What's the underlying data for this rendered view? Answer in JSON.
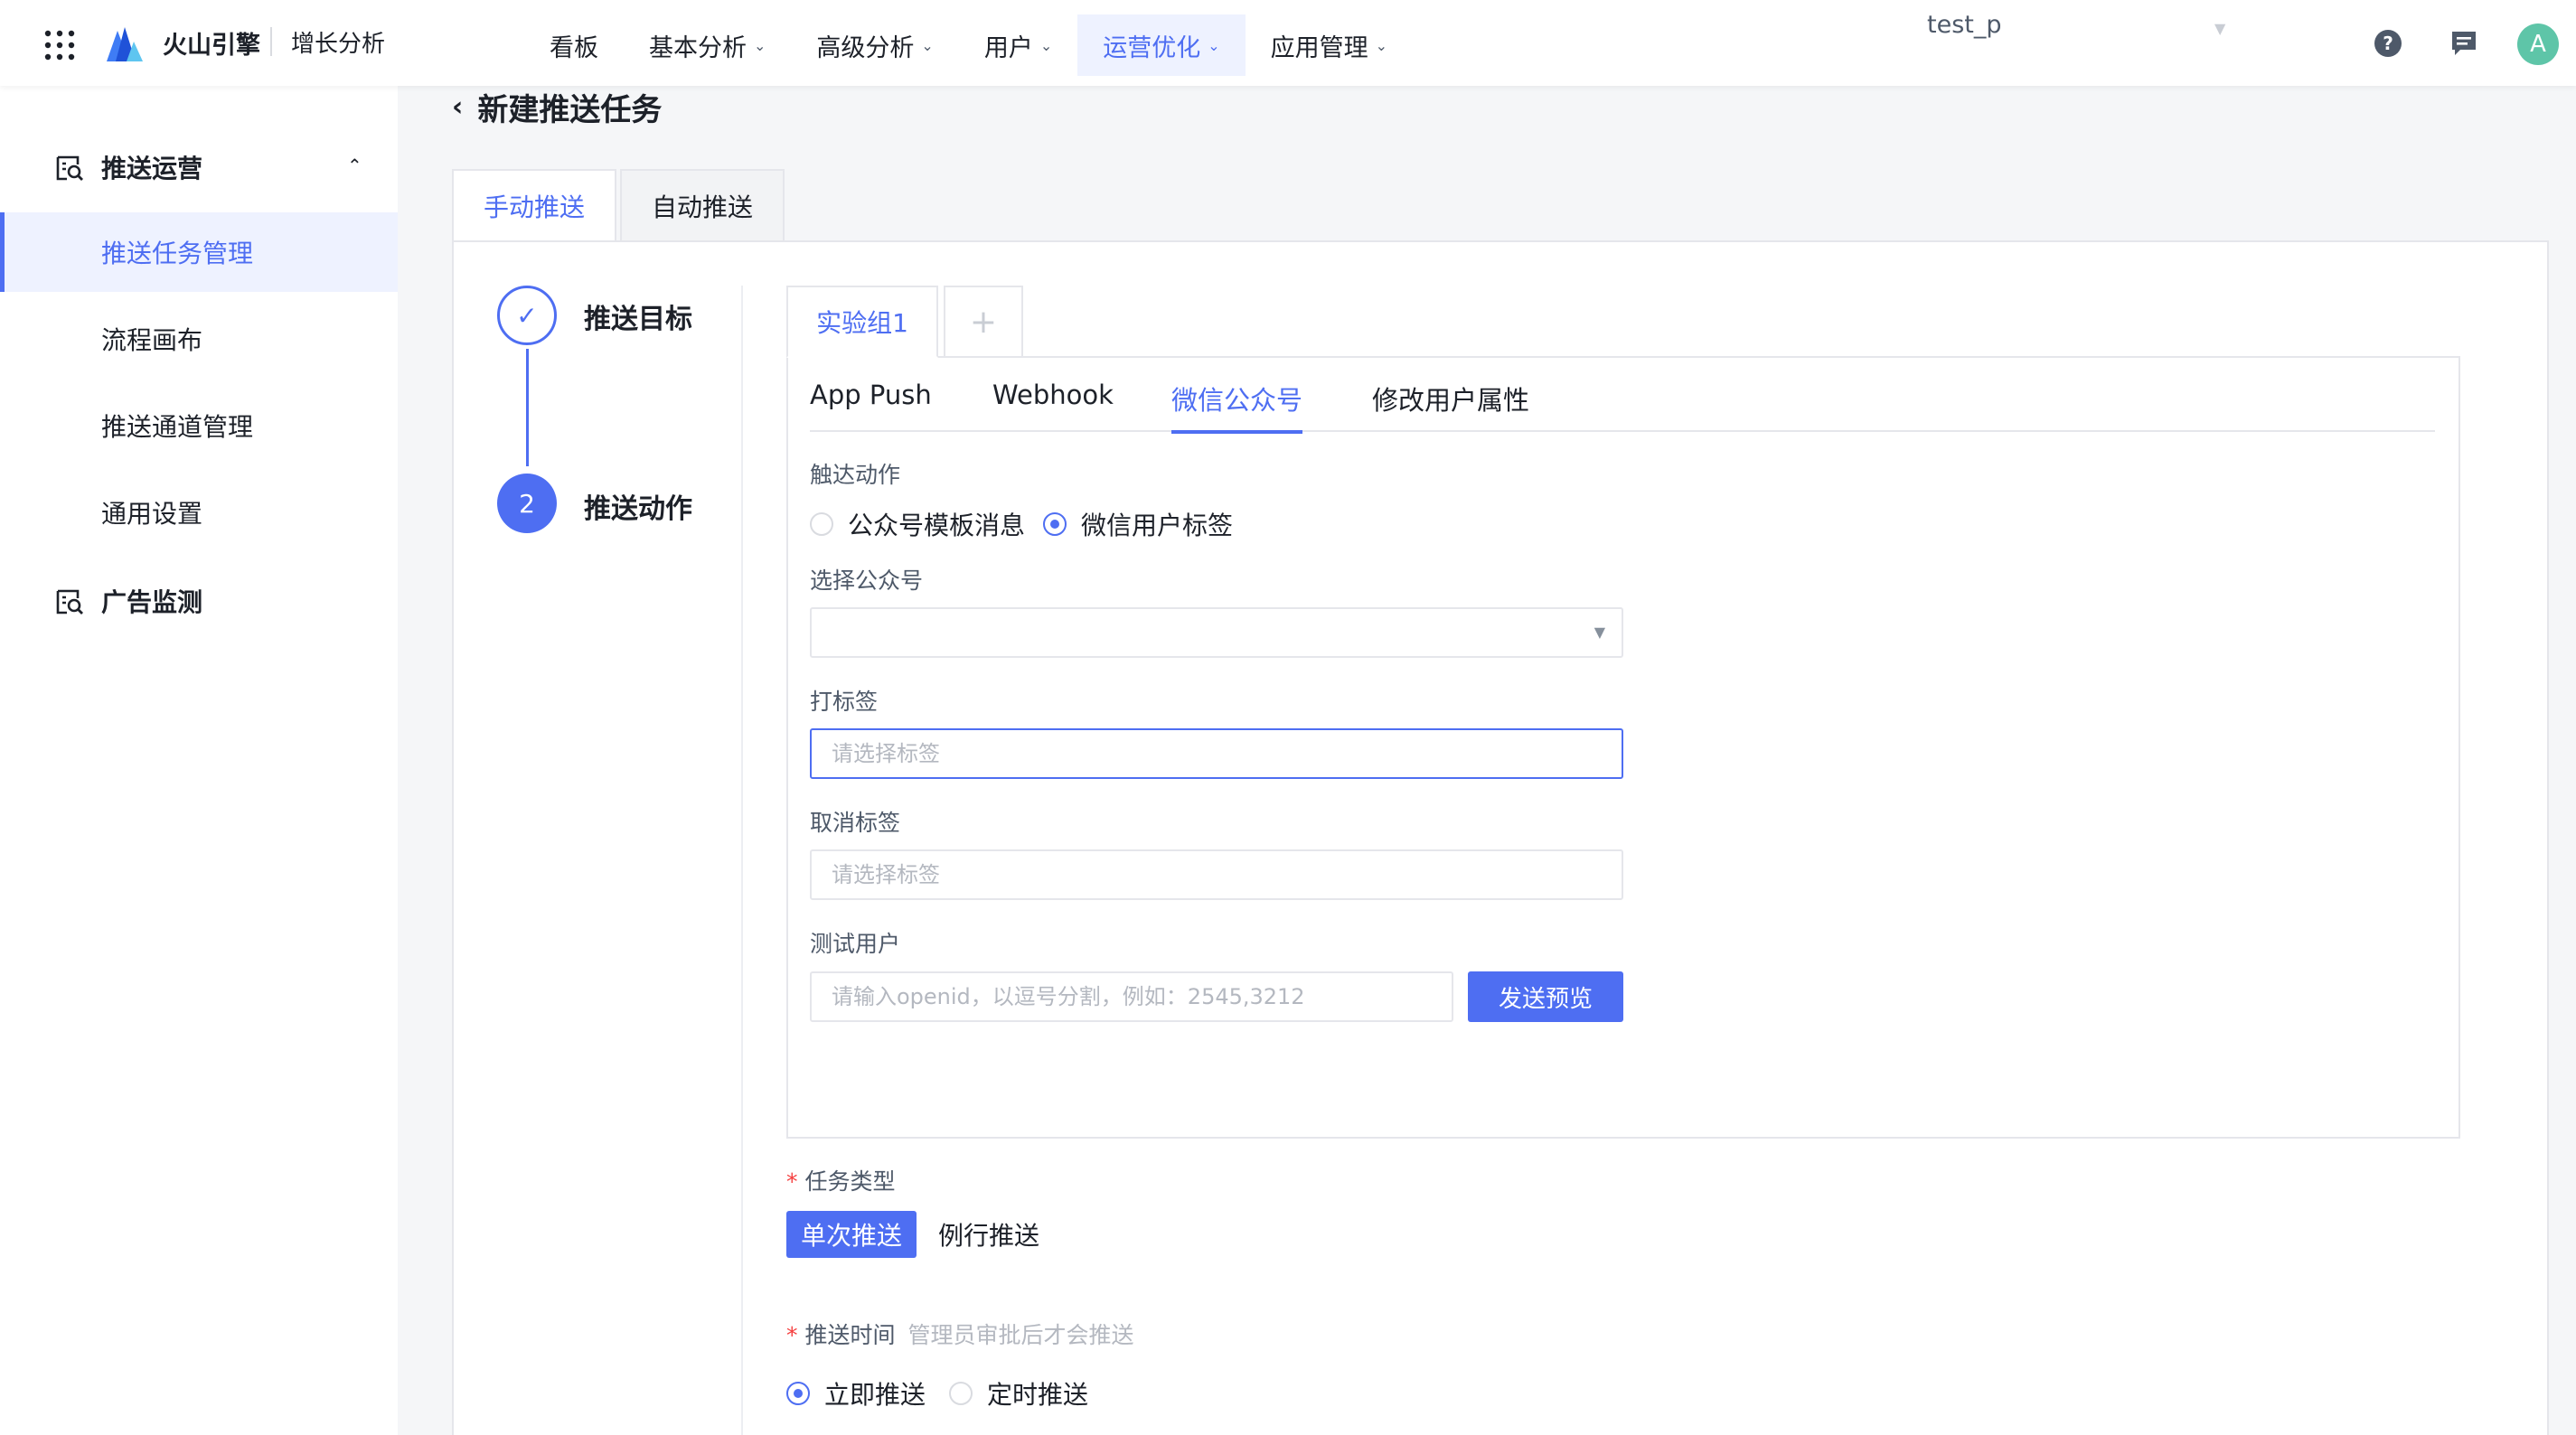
{
  "topbar": {
    "brand": "火山引擎",
    "product": "增长分析",
    "nav": [
      {
        "label": "看板",
        "has_dropdown": false,
        "active": false
      },
      {
        "label": "基本分析",
        "has_dropdown": true,
        "active": false
      },
      {
        "label": "高级分析",
        "has_dropdown": true,
        "active": false
      },
      {
        "label": "用户",
        "has_dropdown": true,
        "active": false
      },
      {
        "label": "运营优化",
        "has_dropdown": true,
        "active": true
      },
      {
        "label": "应用管理",
        "has_dropdown": true,
        "active": false
      }
    ],
    "chevron": "⌄",
    "project": "test_p",
    "project_caret": "▼",
    "avatar_letter": "A",
    "icons": [
      "apps-grid-icon",
      "volcano-logo-icon",
      "help-icon",
      "message-icon"
    ]
  },
  "sidebar": {
    "groups": [
      {
        "label": "推送运营",
        "expanded": true,
        "chevron": "⌃"
      },
      {
        "label": "广告监测",
        "expanded": false
      }
    ],
    "items": [
      {
        "label": "推送任务管理",
        "active": true
      },
      {
        "label": "流程画布",
        "active": false
      },
      {
        "label": "推送通道管理",
        "active": false
      },
      {
        "label": "通用设置",
        "active": false
      }
    ]
  },
  "page": {
    "back_arrow": "‹",
    "title": "新建推送任务",
    "tabs": [
      {
        "label": "手动推送",
        "active": true
      },
      {
        "label": "自动推送",
        "active": false
      }
    ]
  },
  "steps": [
    {
      "label": "推送目标",
      "status": "done",
      "mark": "✓"
    },
    {
      "label": "推送动作",
      "status": "current",
      "mark": "2"
    }
  ],
  "groups": {
    "tabs": [
      {
        "label": "实验组1",
        "active": true
      }
    ],
    "add_label": "+"
  },
  "channels": {
    "tabs": [
      {
        "label": "App Push",
        "active": false
      },
      {
        "label": "Webhook",
        "active": false
      },
      {
        "label": "微信公众号",
        "active": true
      },
      {
        "label": "修改用户属性",
        "active": false
      }
    ]
  },
  "form": {
    "action_label": "触达动作",
    "action_options": [
      {
        "label": "公众号模板消息",
        "checked": false
      },
      {
        "label": "微信用户标签",
        "checked": true
      }
    ],
    "account_label": "选择公众号",
    "account_value": "",
    "account_caret": "▼",
    "tag_label": "打标签",
    "tag_placeholder": "请选择标签",
    "untag_label": "取消标签",
    "untag_placeholder": "请选择标签",
    "test_user_label": "测试用户",
    "test_user_placeholder": "请输入openid，以逗号分割，例如：2545,3212",
    "preview_button": "发送预览",
    "required_mark": "*",
    "task_type_label": "任务类型",
    "task_types": [
      {
        "label": "单次推送",
        "active": true
      },
      {
        "label": "例行推送",
        "active": false
      }
    ],
    "push_time_label": "推送时间",
    "push_time_hint": "管理员审批后才会推送",
    "push_time_options": [
      {
        "label": "立即推送",
        "checked": true
      },
      {
        "label": "定时推送",
        "checked": false
      }
    ]
  },
  "colors": {
    "accent": "#4e6ef2",
    "active_bg": "#eef2ff",
    "avatar_bg": "#5ec5a8",
    "required": "#f53f3f"
  }
}
